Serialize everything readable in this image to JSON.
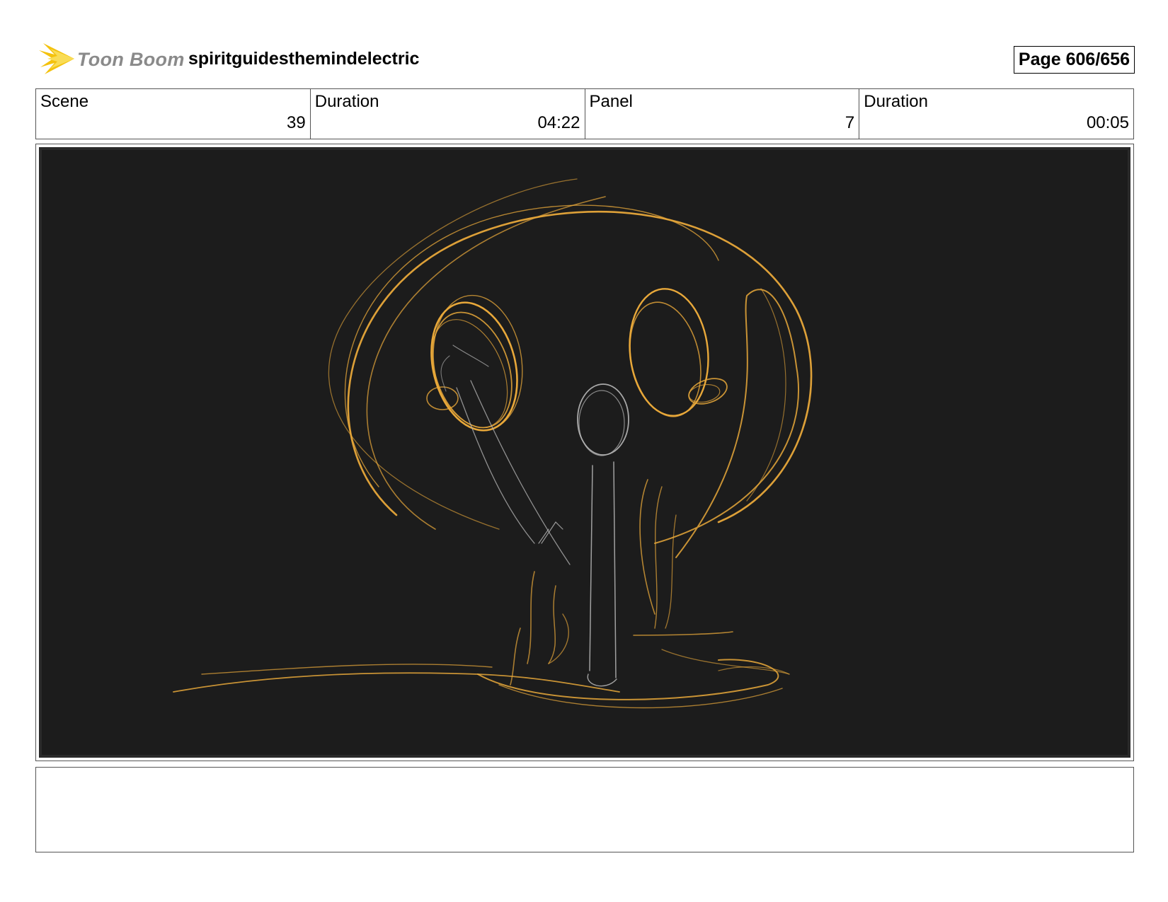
{
  "header": {
    "logo_text": "Toon Boom",
    "project_title": "spiritguidesthemindelectric",
    "page_label": "Page 606/656"
  },
  "info": {
    "scene_label": "Scene",
    "scene_value": "39",
    "scene_duration_label": "Duration",
    "scene_duration_value": "04:22",
    "panel_label": "Panel",
    "panel_value": "7",
    "panel_duration_label": "Duration",
    "panel_duration_value": "00:05"
  },
  "colors": {
    "sketch_gold": "#e8a83a",
    "sketch_grey": "#b8b8b8",
    "panel_bg": "#1c1c1c"
  }
}
